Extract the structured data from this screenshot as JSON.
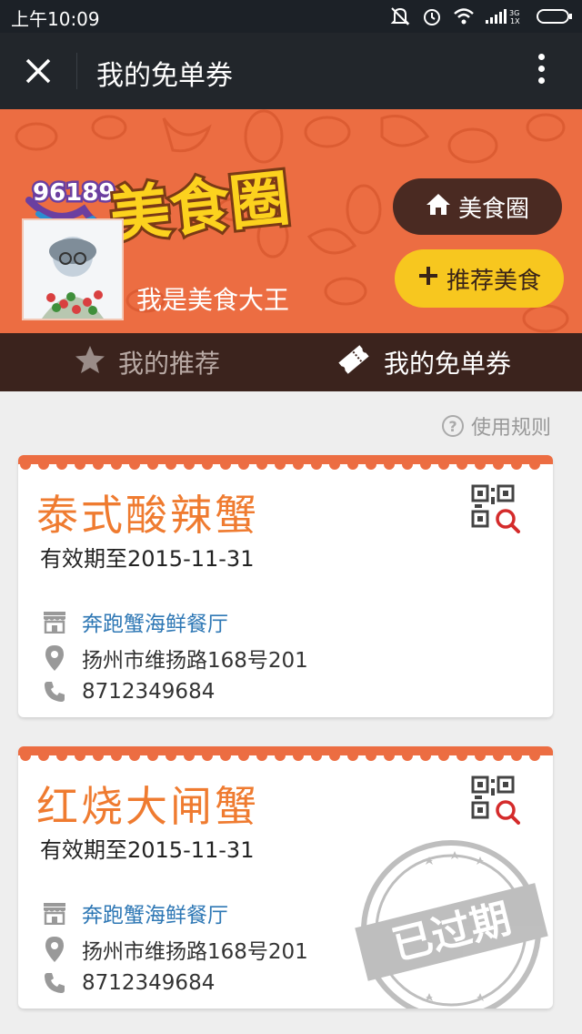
{
  "status_bar": {
    "time": "上午10:09",
    "network_label": "3G\n1X"
  },
  "nav": {
    "title": "我的免单券"
  },
  "header": {
    "logo_number": "96189",
    "logo_text": "美食圈",
    "username": "我是美食大王",
    "food_circle_button": "美食圈",
    "recommend_button": "推荐美食"
  },
  "tabs": [
    {
      "label": "我的推荐",
      "active": false
    },
    {
      "label": "我的免单券",
      "active": true
    }
  ],
  "rules_link": "使用规则",
  "coupons": [
    {
      "title": "泰式酸辣蟹",
      "expiry": "有效期至2015-11-31",
      "restaurant": "奔跑蟹海鲜餐厅",
      "address": "扬州市维扬路168号201",
      "phone": "8712349684",
      "expired": false
    },
    {
      "title": "红烧大闸蟹",
      "expiry": "有效期至2015-11-31",
      "restaurant": "奔跑蟹海鲜餐厅",
      "address": "扬州市维扬路168号201",
      "phone": "8712349684",
      "expired": true,
      "stamp_text": "已过期"
    }
  ],
  "colors": {
    "banner": "#ec6d42",
    "tab_bar": "#3b231d",
    "title_orange": "#ef7b30",
    "link_blue": "#2f78b5",
    "yellow_button": "#f7c71f"
  }
}
